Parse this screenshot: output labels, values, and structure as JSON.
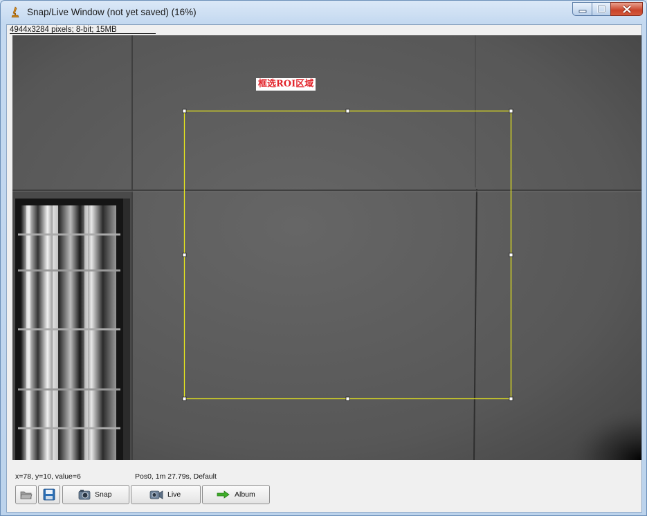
{
  "window": {
    "title": "Snap/Live Window (not yet saved) (16%)",
    "title_icon": "imagej-microscope-icon",
    "controls": [
      "minimize-icon",
      "maximize-icon",
      "close-icon"
    ]
  },
  "image_info": "4944x3284 pixels; 8-bit; 15MB",
  "roi": {
    "label": "框选ROI区域",
    "stroke_color": "#e8e81c",
    "label_color": "#e2242b"
  },
  "status": {
    "cursor": "x=78, y=10, value=6",
    "position": "Pos0, 1m 27.79s, Default"
  },
  "toolbar": {
    "open_icon": "folder-icon",
    "save_icon": "floppy-disk-icon",
    "snap_label": "Snap",
    "snap_icon": "camera-icon",
    "live_label": "Live",
    "live_icon": "video-camera-icon",
    "album_label": "Album",
    "album_icon": "green-arrow-right-icon"
  }
}
